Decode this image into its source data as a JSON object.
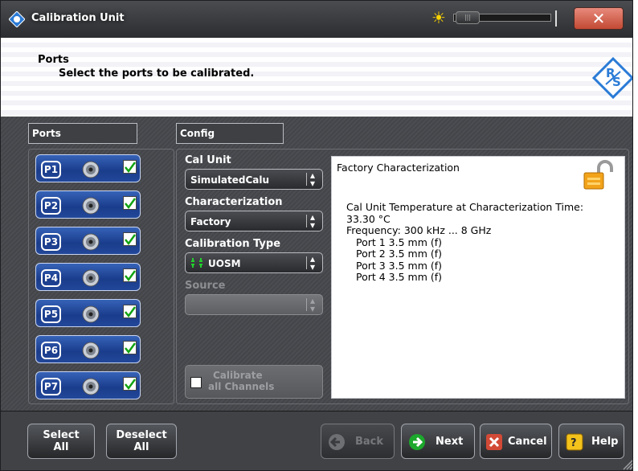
{
  "window": {
    "title": "Calibration Unit"
  },
  "header": {
    "title": "Ports",
    "subtitle": "Select the ports to be calibrated."
  },
  "groups": {
    "ports": "Ports",
    "config": "Config"
  },
  "ports": [
    {
      "label": "P1",
      "checked": true
    },
    {
      "label": "P2",
      "checked": true
    },
    {
      "label": "P3",
      "checked": true
    },
    {
      "label": "P4",
      "checked": true
    },
    {
      "label": "P5",
      "checked": true
    },
    {
      "label": "P6",
      "checked": true
    },
    {
      "label": "P7",
      "checked": true
    }
  ],
  "config": {
    "cal_unit_label": "Cal Unit",
    "cal_unit_value": "SimulatedCalu",
    "characterization_label": "Characterization",
    "characterization_value": "Factory",
    "calibration_type_label": "Calibration Type",
    "calibration_type_value": "UOSM",
    "source_label": "Source",
    "source_value": "",
    "calibrate_all_line1": "Calibrate",
    "calibrate_all_line2": "all Channels"
  },
  "info": {
    "title": "Factory Characterization",
    "lines": [
      "Cal Unit Temperature at Characterization Time:",
      "33.30 °C",
      "Frequency: 300 kHz ... 8 GHz"
    ],
    "ports": [
      "Port 1 3.5 mm (f)",
      "Port 2 3.5 mm (f)",
      "Port 3 3.5 mm (f)",
      "Port 4 3.5 mm (f)"
    ]
  },
  "footer": {
    "select_all": [
      "Select",
      "All"
    ],
    "deselect_all": [
      "Deselect",
      "All"
    ],
    "back": "Back",
    "next": "Next",
    "cancel": "Cancel",
    "help": "Help"
  },
  "colors": {
    "accent": "#1a3c8b",
    "close": "#c24933"
  }
}
